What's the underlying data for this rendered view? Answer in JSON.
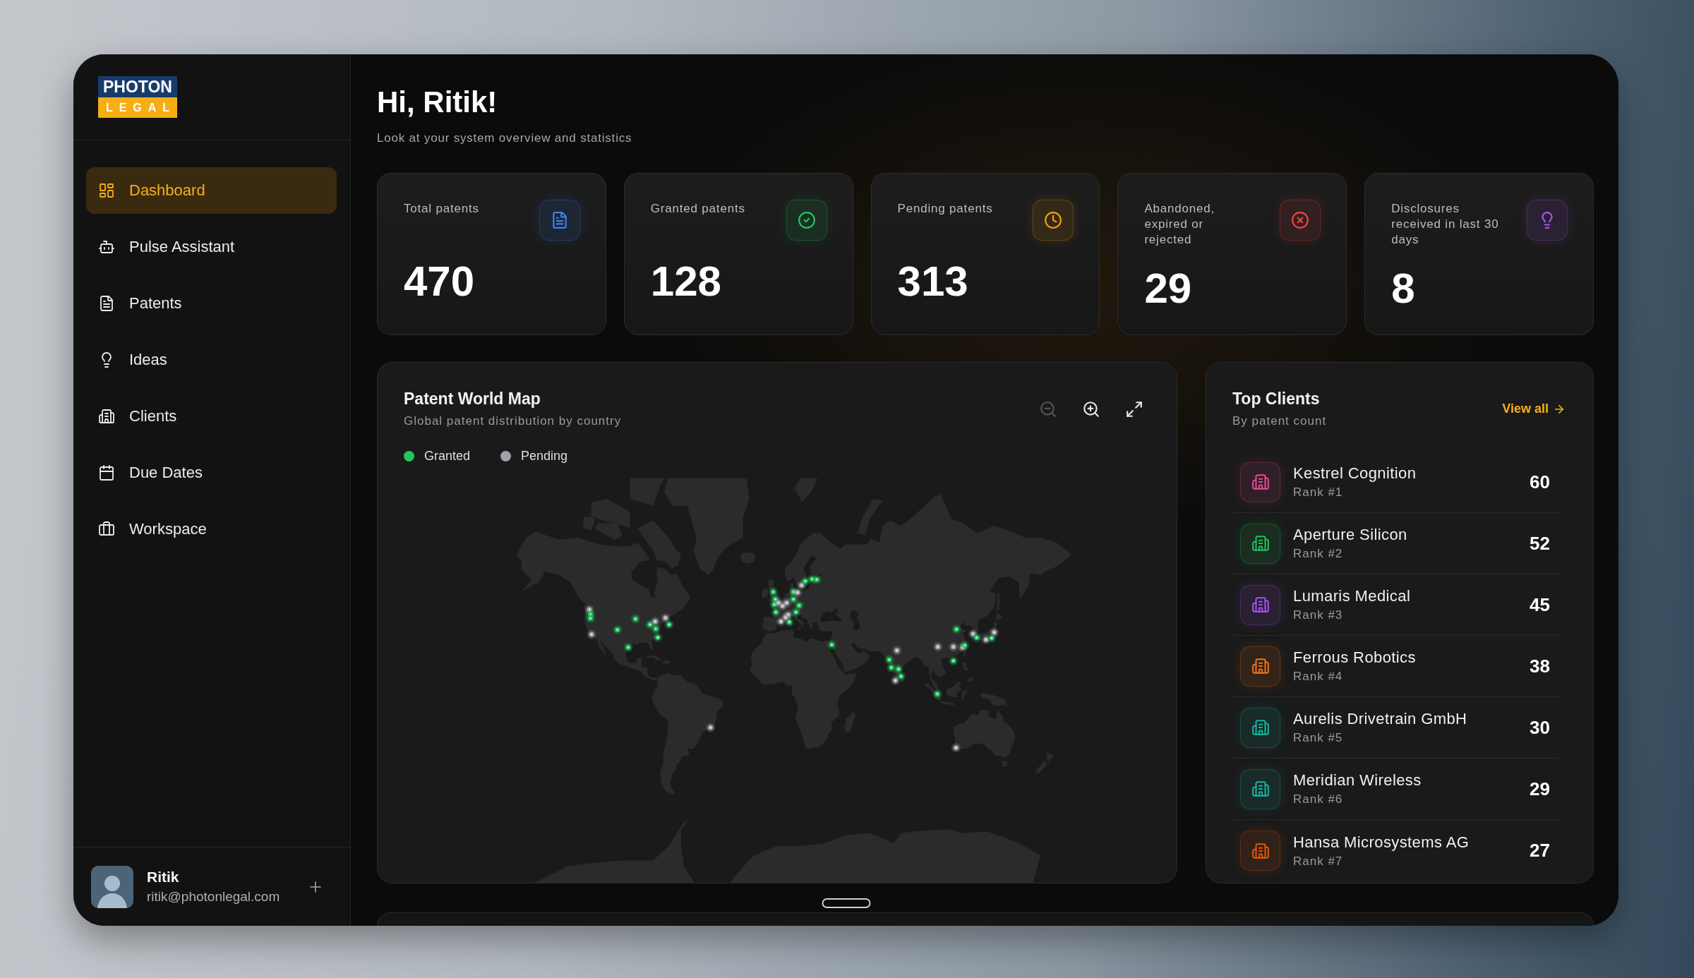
{
  "sidebar": {
    "logo": {
      "line_1": "PHOTON",
      "line_2": "LEGAL"
    },
    "items": [
      {
        "label": "Dashboard",
        "selected": true
      },
      {
        "label": "Pulse Assistant",
        "selected": false
      },
      {
        "label": "Patents",
        "selected": false
      },
      {
        "label": "Ideas",
        "selected": false
      },
      {
        "label": "Clients",
        "selected": false
      },
      {
        "label": "Due Dates",
        "selected": false
      },
      {
        "label": "Workspace",
        "selected": false
      }
    ],
    "user": {
      "name": "Ritik",
      "email": "ritik@photonlegal.com"
    }
  },
  "header": {
    "title": "Hi, Ritik!",
    "subtitle": "Look at your system overview and statistics"
  },
  "stats": [
    {
      "label": "Total patents",
      "value": "470",
      "color": "#3b82f6"
    },
    {
      "label": "Granted patents",
      "value": "128",
      "color": "#22c55e"
    },
    {
      "label": "Pending patents",
      "value": "313",
      "color": "#f59e0b"
    },
    {
      "label": "Abandoned, expired or rejected",
      "value": "29",
      "color": "#ef4444"
    },
    {
      "label": "Disclosures received in last 30 days",
      "value": "8",
      "color": "#a855f7"
    }
  ],
  "world_map": {
    "title": "Patent World Map",
    "subtitle": "Global patent distribution by country",
    "controls": [
      {
        "kind": "zoom_out",
        "disabled": true
      },
      {
        "kind": "zoom_in",
        "disabled": false
      },
      {
        "kind": "fullscreen",
        "disabled": false
      }
    ],
    "legend": [
      {
        "label": "Granted",
        "color": "#22c55e"
      },
      {
        "label": "Pending",
        "color": "#a1a1aa"
      }
    ]
  },
  "top_clients": {
    "title": "Top Clients",
    "subtitle": "By patent count",
    "link": "View all",
    "clients": [
      {
        "name": "Kestrel Cognition",
        "rank": "Rank #1",
        "count": "60",
        "color": "#ec4899"
      },
      {
        "name": "Aperture Silicon",
        "rank": "Rank #2",
        "count": "52",
        "color": "#22c55e"
      },
      {
        "name": "Lumaris Medical",
        "rank": "Rank #3",
        "count": "45",
        "color": "#a855f7"
      },
      {
        "name": "Ferrous Robotics",
        "rank": "Rank #4",
        "count": "38",
        "color": "#f97316"
      },
      {
        "name": "Aurelis Drivetrain GmbH",
        "rank": "Rank #5",
        "count": "30",
        "color": "#14b8a6"
      },
      {
        "name": "Meridian Wireless",
        "rank": "Rank #6",
        "count": "29",
        "color": "#14b8a6"
      },
      {
        "name": "Hansa Microsystems AG",
        "rank": "Rank #7",
        "count": "27",
        "color": "#ea580c"
      }
    ]
  }
}
